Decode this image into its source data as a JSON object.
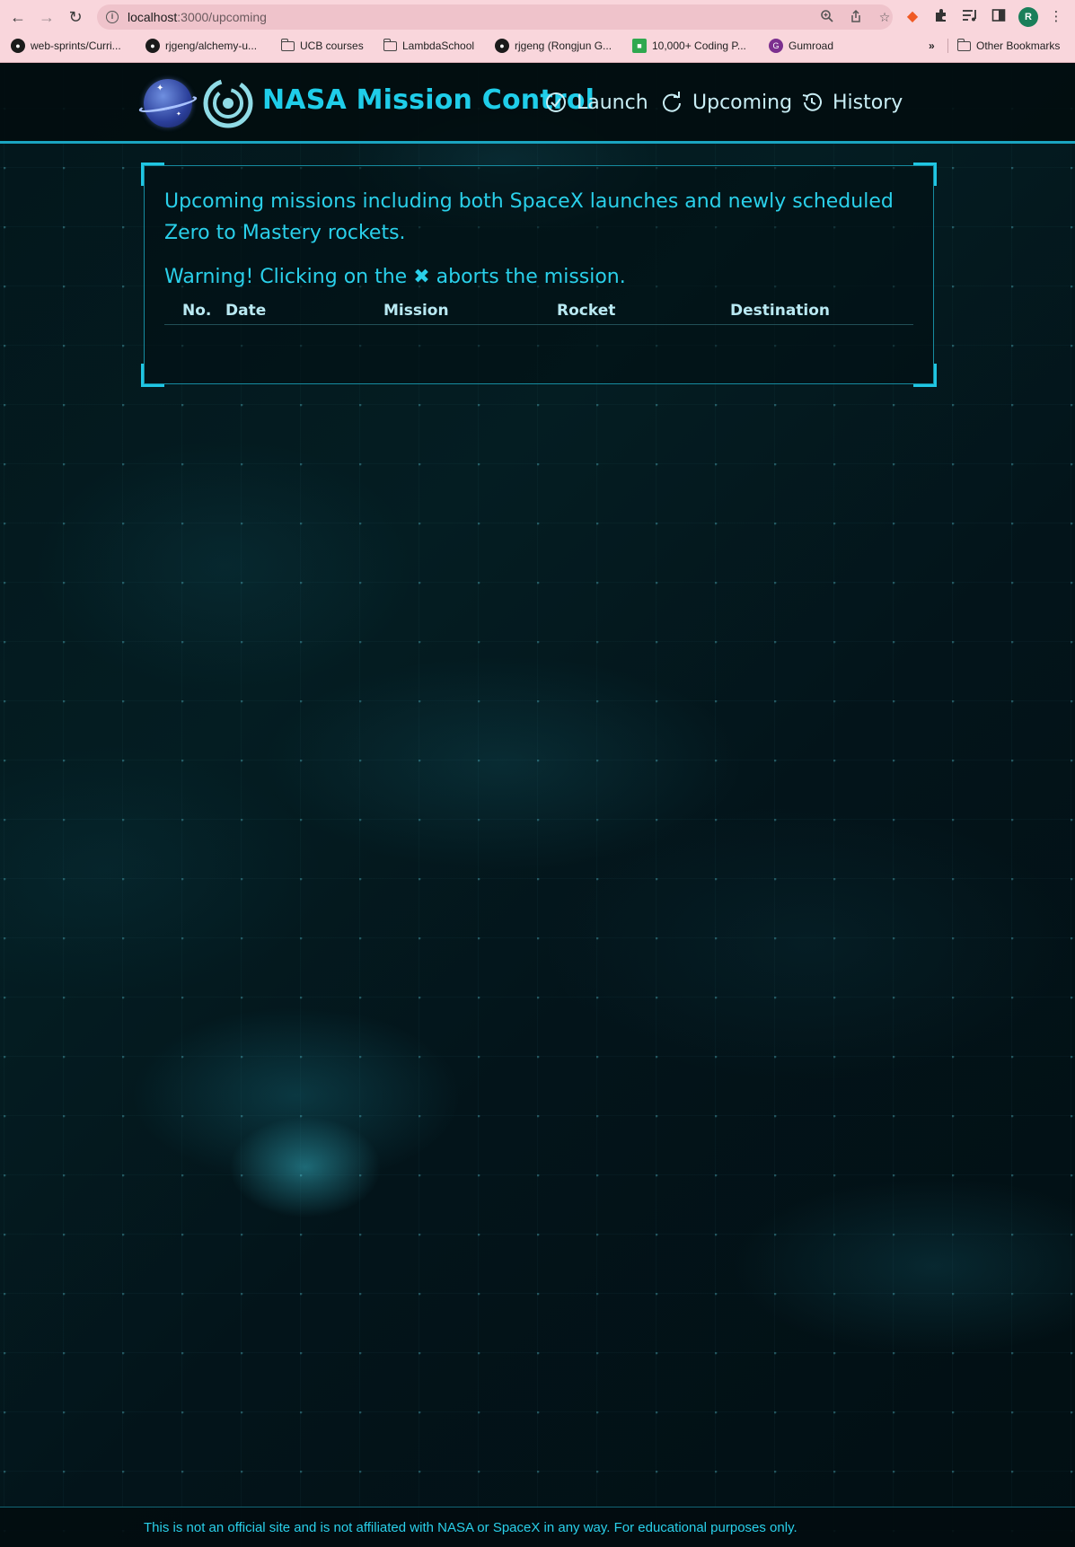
{
  "browser": {
    "url_host": "localhost",
    "url_path": ":3000/upcoming",
    "profile_initial": "R",
    "bookmarks": [
      {
        "label": "web-sprints/Curri...",
        "icon": "github-icon"
      },
      {
        "label": "rjgeng/alchemy-u...",
        "icon": "github-icon"
      },
      {
        "label": "UCB courses",
        "icon": "folder-icon"
      },
      {
        "label": "LambdaSchool",
        "icon": "folder-icon"
      },
      {
        "label": "rjgeng (Rongjun G...",
        "icon": "github-icon"
      },
      {
        "label": "10,000+ Coding P...",
        "icon": "coding-problems-icon"
      },
      {
        "label": "Gumroad",
        "icon": "gumroad-icon"
      }
    ],
    "overflow_label": "»",
    "other_bookmarks_label": "Other Bookmarks"
  },
  "header": {
    "title": "NASA Mission Control",
    "nav": [
      {
        "label": "Launch",
        "icon": "check-circle-icon"
      },
      {
        "label": "Upcoming",
        "icon": "refresh-icon"
      },
      {
        "label": "History",
        "icon": "history-icon"
      }
    ]
  },
  "content": {
    "intro": "Upcoming missions including both SpaceX launches and newly scheduled Zero to Mastery rockets.",
    "warning_before": "Warning! Clicking on the",
    "warning_symbol": "✖",
    "warning_after": "aborts the mission.",
    "table": {
      "columns": [
        "No.",
        "Date",
        "Mission",
        "Rocket",
        "Destination"
      ],
      "rows": []
    }
  },
  "footer": {
    "text": "This is not an official site and is not affiliated with NASA or SpaceX in any way. For educational purposes only."
  },
  "colors": {
    "accent": "#1fcde9",
    "background": "#020c0f",
    "browser_chrome": "#f9d6dc"
  }
}
